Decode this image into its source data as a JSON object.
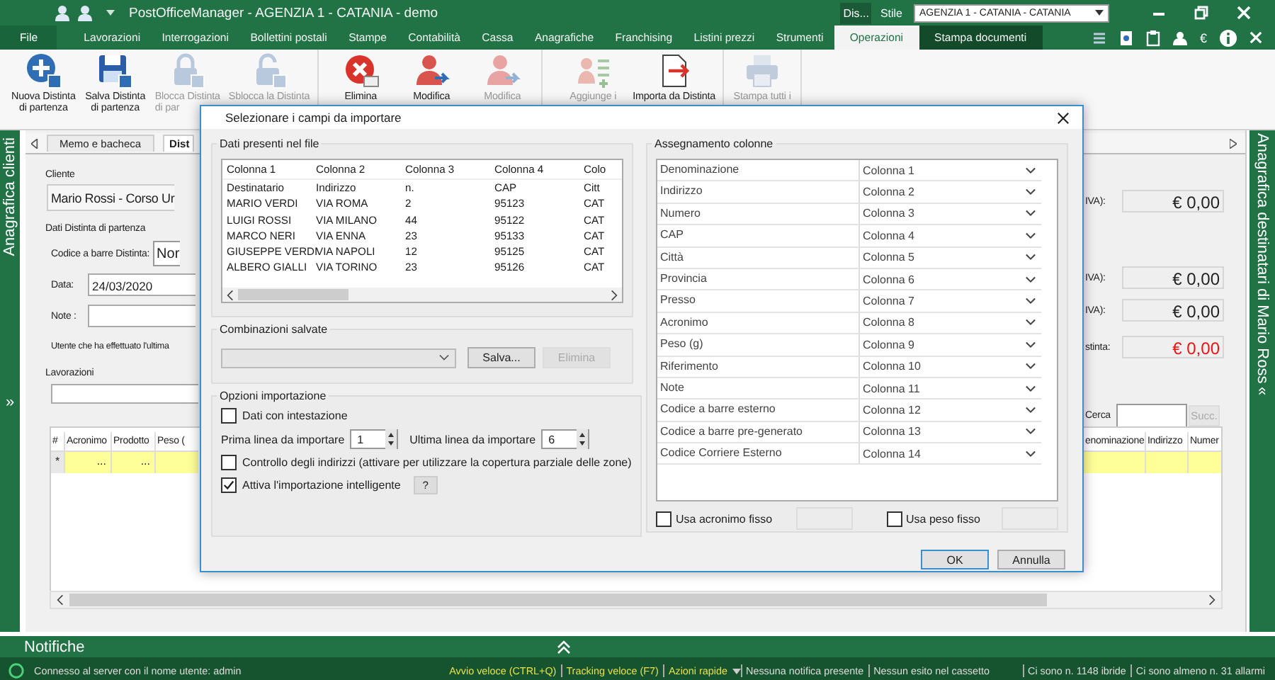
{
  "window": {
    "title": "PostOfficeManager - AGENZIA 1 - CATANIA - demo",
    "display_label": "Dis...",
    "style_label": "Stile",
    "agency": "AGENZIA 1 - CATANIA - CATANIA"
  },
  "menu": {
    "file": "File",
    "currency": "€",
    "tabs": [
      {
        "label": "Lavorazioni",
        "selected": false,
        "kind": "normal"
      },
      {
        "label": "Interrogazioni",
        "selected": false,
        "kind": "normal"
      },
      {
        "label": "Bollettini postali",
        "selected": false,
        "kind": "normal"
      },
      {
        "label": "Stampe",
        "selected": false,
        "kind": "normal"
      },
      {
        "label": "Contabilità",
        "selected": false,
        "kind": "normal"
      },
      {
        "label": "Cassa",
        "selected": false,
        "kind": "normal"
      },
      {
        "label": "Anagrafiche",
        "selected": false,
        "kind": "normal"
      },
      {
        "label": "Franchising",
        "selected": false,
        "kind": "normal"
      },
      {
        "label": "Listini prezzi",
        "selected": false,
        "kind": "normal"
      },
      {
        "label": "Strumenti",
        "selected": false,
        "kind": "normal"
      },
      {
        "label": "Operazioni",
        "selected": true,
        "kind": "normal"
      },
      {
        "label": "Stampa documenti",
        "selected": false,
        "kind": "contextual"
      }
    ]
  },
  "ribbon": {
    "groups": [
      {
        "buttons": [
          {
            "lines": [
              "Nuova Distinta",
              "di partenza"
            ],
            "kind": "new",
            "disabled": false,
            "cut_off": false
          },
          {
            "lines": [
              "Salva Distinta",
              "di partenza"
            ],
            "kind": "save",
            "disabled": false,
            "cut_off": false
          },
          {
            "lines": [
              "Blocca Distinta",
              "di par"
            ],
            "kind": "lock",
            "disabled": true,
            "cut_off": true
          },
          {
            "lines": [
              "Sblocca la Distinta"
            ],
            "kind": "unlock",
            "disabled": true,
            "cut_off": false
          }
        ]
      },
      {
        "buttons": [
          {
            "lines": [
              "Elimina"
            ],
            "kind": "delete",
            "disabled": false,
            "cut_off": false
          },
          {
            "lines": [
              "Modifica"
            ],
            "kind": "edit",
            "disabled": false,
            "cut_off": false
          },
          {
            "lines": [
              "Modifica"
            ],
            "kind": "edit",
            "disabled": true,
            "cut_off": false
          }
        ]
      },
      {
        "buttons": [
          {
            "lines": [
              "Aggiunge i"
            ],
            "kind": "add",
            "disabled": true,
            "cut_off": false
          },
          {
            "lines": [
              "Importa da Distinta"
            ],
            "kind": "import",
            "disabled": false,
            "cut_off": false
          }
        ]
      },
      {
        "buttons": [
          {
            "lines": [
              "Stampa tutti i"
            ],
            "kind": "print",
            "disabled": true,
            "cut_off": false
          }
        ]
      }
    ]
  },
  "left_sidebar": {
    "label": "Anagrafica clienti",
    "toggle": "»"
  },
  "right_sidebar": {
    "label": "Anagrafica destinatari di Mario Ross",
    "toggle": "«"
  },
  "document_tabs": [
    {
      "label": "Memo e bacheca",
      "selected": false
    },
    {
      "label": "Dist",
      "selected": true
    }
  ],
  "form": {
    "client_label": "Cliente",
    "client": "Mario Rossi - Corso Ur",
    "section": "Dati Distinta di partenza",
    "barcode_label": "Codice a barre Distinta:",
    "barcode": "Nor",
    "date_label": "Data:",
    "date": "24/03/2020",
    "note_label": "Note :",
    "last_user_label": "Utente che ha effettuato l'ultima",
    "totals": [
      {
        "label": "IVA):",
        "value": "€ 0,00",
        "alert": false
      },
      {
        "label": "IVA):",
        "value": "€ 0,00",
        "alert": false
      },
      {
        "label": "IVA):",
        "value": "€ 0,00",
        "alert": false
      },
      {
        "label": "stinta:",
        "value": "€ 0,00",
        "alert": true
      }
    ]
  },
  "lavorazioni": {
    "title": "Lavorazioni",
    "search_label": "Cerca",
    "next_button": "Succ.",
    "columns_left": [
      "#",
      "Acronimo",
      "Prodotto",
      "Peso ("
    ],
    "row_left": [
      "*",
      "...",
      "..."
    ],
    "columns_right": [
      "enominazione",
      "Indirizzo",
      "Numer"
    ]
  },
  "dialog": {
    "title": "Selezionare i campi da importare",
    "file_data": {
      "title": "Dati presenti nel file",
      "columns": [
        "Colonna 1",
        "Colonna 2",
        "Colonna 3",
        "Colonna 4",
        "Colo"
      ],
      "rows": [
        [
          "Destinatario",
          "Indirizzo",
          "n.",
          "CAP",
          "Citt"
        ],
        [
          "MARIO VERDI",
          "VIA ROMA",
          "2",
          "95123",
          "CAT"
        ],
        [
          "LUIGI ROSSI",
          "VIA MILANO",
          "44",
          "95122",
          "CAT"
        ],
        [
          "MARCO NERI",
          "VIA ENNA",
          "23",
          "95133",
          "CAT"
        ],
        [
          "GIUSEPPE VERDI",
          "VIA NAPOLI",
          "12",
          "95125",
          "CAT"
        ],
        [
          "ALBERO GIALLI",
          "VIA TORINO",
          "23",
          "95126",
          "CAT"
        ]
      ]
    },
    "saved": {
      "title": "Combinazioni salvate",
      "buttons": [
        {
          "label": "Salva...",
          "disabled": false
        },
        {
          "label": "Elimina",
          "disabled": true
        }
      ]
    },
    "options": {
      "title": "Opzioni importazione",
      "with_header": {
        "label": "Dati con intestazione",
        "checked": false
      },
      "first_line": {
        "label": "Prima linea da importare",
        "value": "1"
      },
      "last_line": {
        "label": "Ultima linea da importare",
        "value": "6"
      },
      "address_check": {
        "label": "Controllo degli indirizzi (attivare per utilizzare la copertura parziale delle zone)",
        "checked": false
      },
      "smart_import": {
        "label": "Attiva l'importazione intelligente",
        "checked": true
      },
      "help": "?"
    },
    "mapping": {
      "title": "Assegnamento colonne",
      "rows": [
        {
          "field": "Denominazione",
          "column": "Colonna 1"
        },
        {
          "field": "Indirizzo",
          "column": "Colonna 2"
        },
        {
          "field": "Numero",
          "column": "Colonna 3"
        },
        {
          "field": "CAP",
          "column": "Colonna 4"
        },
        {
          "field": "Città",
          "column": "Colonna 5"
        },
        {
          "field": "Provincia",
          "column": "Colonna 6"
        },
        {
          "field": "Presso",
          "column": "Colonna 7"
        },
        {
          "field": "Acronimo",
          "column": "Colonna 8"
        },
        {
          "field": "Peso (g)",
          "column": "Colonna 9"
        },
        {
          "field": "Riferimento",
          "column": "Colonna 10"
        },
        {
          "field": "Note",
          "column": "Colonna 11"
        },
        {
          "field": "Codice a barre esterno",
          "column": "Colonna 12"
        },
        {
          "field": "Codice a barre pre-generato",
          "column": "Colonna 13"
        },
        {
          "field": "Codice Corriere Esterno",
          "column": "Colonna 14"
        }
      ],
      "fixed_acronym": {
        "label": "Usa acronimo fisso",
        "checked": false
      },
      "fixed_weight": {
        "label": "Usa peso fisso",
        "checked": false
      }
    },
    "buttons": [
      {
        "label": "OK",
        "default": true
      },
      {
        "label": "Annulla",
        "default": false
      }
    ]
  },
  "notifications": {
    "title": "Notifiche"
  },
  "status_bar": {
    "connection": "Connesso al server con il nome utente: admin",
    "quick_links": [
      "Avvio veloce (CTRL+Q)",
      "Tracking veloce (F7)",
      "Azioni rapide"
    ],
    "messages": [
      "Nessuna notifica presente",
      "Nessun esito nel cassetto",
      "Ci sono n. 1148 ibride",
      "Ci sono almeno n. 31 allarmi"
    ]
  }
}
